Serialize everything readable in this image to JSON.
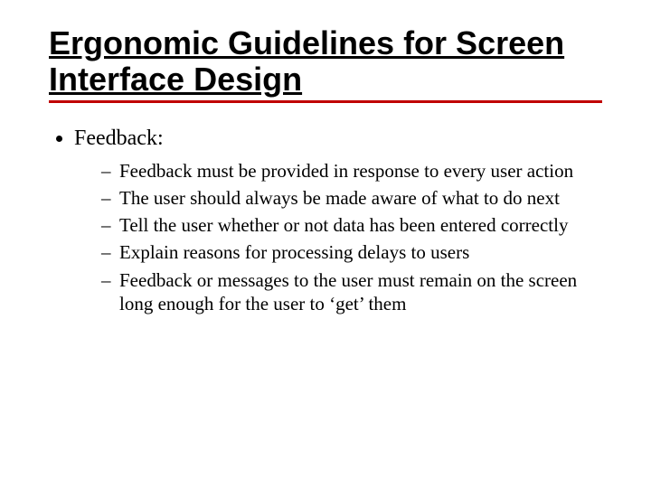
{
  "title": "Ergonomic Guidelines for Screen Interface Design",
  "section": {
    "heading": "Feedback:",
    "items": [
      "Feedback must be provided in response to every user action",
      "The user should always be made aware of what to do next",
      "Tell the user whether or not data has been entered correctly",
      "Explain reasons for processing delays to users",
      "Feedback or messages to the user must remain on the screen long enough for the user to ‘get’ them"
    ]
  }
}
